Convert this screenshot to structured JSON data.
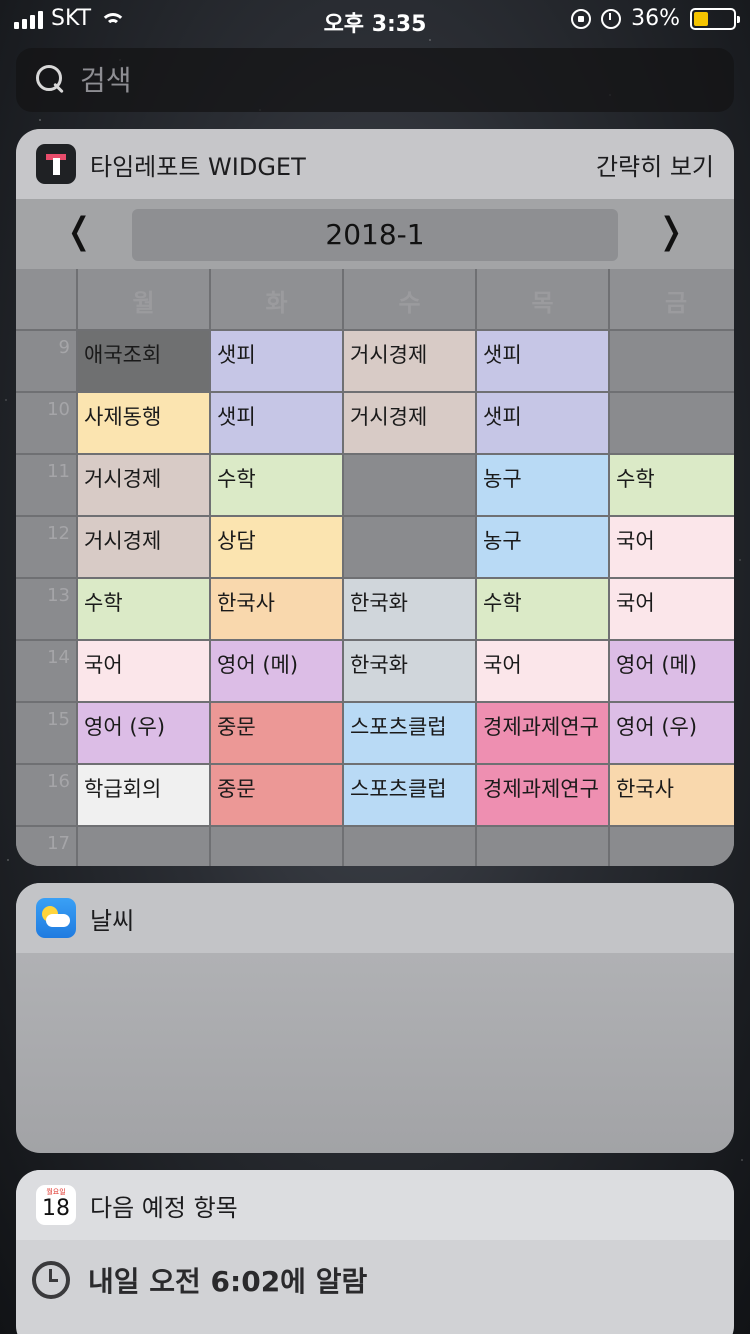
{
  "status_bar": {
    "carrier": "SKT",
    "time": "오후 3:35",
    "battery": "36%",
    "battery_level": 0.36
  },
  "search": {
    "placeholder": "검색"
  },
  "timetable_widget": {
    "app_name": "타임레포트 WIDGET",
    "show_less": "간략히 보기",
    "prev": "❬",
    "next": "❭",
    "semester": "2018-1",
    "days": [
      "월",
      "화",
      "수",
      "목",
      "금"
    ],
    "hours": [
      "9",
      "10",
      "11",
      "12",
      "13",
      "14",
      "15",
      "16",
      "17"
    ],
    "rows": [
      [
        {
          "t": "애국조회",
          "c": "#6f7071"
        },
        {
          "t": "샛피",
          "c": "#c6c6e6"
        },
        {
          "t": "거시경제",
          "c": "#d8cbc6"
        },
        {
          "t": "샛피",
          "c": "#c6c6e6"
        },
        {
          "t": "",
          "c": ""
        }
      ],
      [
        {
          "t": "사제동행",
          "c": "#fbe4b0"
        },
        {
          "t": "샛피",
          "c": "#c6c6e6"
        },
        {
          "t": "거시경제",
          "c": "#d8cbc6"
        },
        {
          "t": "샛피",
          "c": "#c6c6e6"
        },
        {
          "t": "",
          "c": ""
        }
      ],
      [
        {
          "t": "거시경제",
          "c": "#d8cbc6"
        },
        {
          "t": "수학",
          "c": "#dbeac7"
        },
        {
          "t": "",
          "c": ""
        },
        {
          "t": "농구",
          "c": "#b9daf5"
        },
        {
          "t": "수학",
          "c": "#dbeac7"
        }
      ],
      [
        {
          "t": "거시경제",
          "c": "#d8cbc6"
        },
        {
          "t": "상담",
          "c": "#fbe4b0"
        },
        {
          "t": "",
          "c": ""
        },
        {
          "t": "농구",
          "c": "#b9daf5"
        },
        {
          "t": "국어",
          "c": "#fbe6ea"
        }
      ],
      [
        {
          "t": "수학",
          "c": "#dbeac7"
        },
        {
          "t": "한국사",
          "c": "#f9d8ad"
        },
        {
          "t": "한국화",
          "c": "#d0d6db"
        },
        {
          "t": "수학",
          "c": "#dbeac7"
        },
        {
          "t": "국어",
          "c": "#fbe6ea"
        }
      ],
      [
        {
          "t": "국어",
          "c": "#fbe6ea"
        },
        {
          "t": "영어 (메)",
          "c": "#dcbde6"
        },
        {
          "t": "한국화",
          "c": "#d0d6db"
        },
        {
          "t": "국어",
          "c": "#fbe6ea"
        },
        {
          "t": "영어 (메)",
          "c": "#dcbde6"
        }
      ],
      [
        {
          "t": "영어 (우)",
          "c": "#dcbde6"
        },
        {
          "t": "중문",
          "c": "#ec9896"
        },
        {
          "t": "스포츠클럽",
          "c": "#b9daf5"
        },
        {
          "t": "경제과제연구",
          "c": "#ee8fb1"
        },
        {
          "t": "영어 (우)",
          "c": "#dcbde6"
        }
      ],
      [
        {
          "t": "학급회의",
          "c": "#f0f0f0"
        },
        {
          "t": "중문",
          "c": "#ec9896"
        },
        {
          "t": "스포츠클럽",
          "c": "#b9daf5"
        },
        {
          "t": "경제과제연구",
          "c": "#ee8fb1"
        },
        {
          "t": "한국사",
          "c": "#f9d8ad"
        }
      ],
      [
        {
          "t": "",
          "c": ""
        },
        {
          "t": "",
          "c": ""
        },
        {
          "t": "",
          "c": ""
        },
        {
          "t": "",
          "c": ""
        },
        {
          "t": "",
          "c": ""
        }
      ]
    ]
  },
  "weather_widget": {
    "title": "날씨"
  },
  "calendar_widget": {
    "title": "다음 예정 항목",
    "icon_weekday": "월요일",
    "icon_day": "18",
    "alarm_text": "내일 오전 6:02에 알람"
  }
}
